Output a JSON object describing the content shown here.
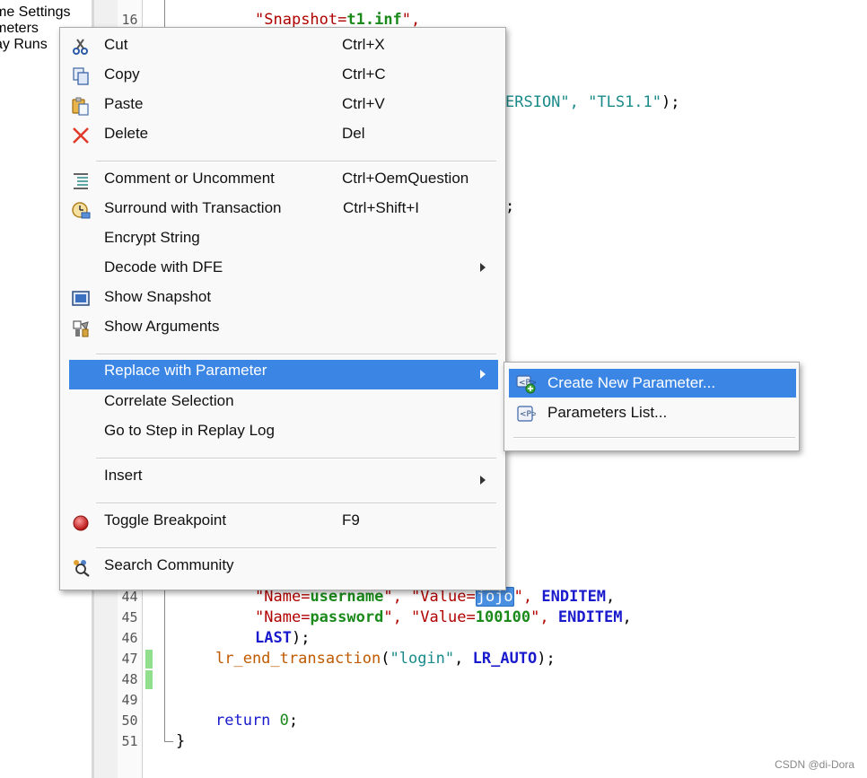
{
  "left_panel": {
    "items": [
      "me Settings",
      "meters",
      "ay Runs"
    ]
  },
  "editor": {
    "line_numbers": [
      "16",
      "44",
      "45",
      "46",
      "47",
      "48",
      "49",
      "50",
      "51"
    ],
    "visible_fragments": {
      "snapshot_open": "\"",
      "snapshot_key": "Snapshot=",
      "snapshot_val": "t1.inf",
      "snapshot_close": "\",",
      "tls_part1": "ERSION\", ",
      "tls_part2": "\"TLS1.1\"",
      "tls_part3": ");",
      "semicolon": ";"
    },
    "line44": {
      "q1": "\"",
      "k1": "Name=",
      "v1": "username",
      "q2": "\", ",
      "q3": "\"",
      "k2": "Value=",
      "v2": "jojo",
      "q4": "\", ",
      "kw": "ENDITEM",
      "end": ","
    },
    "line45": {
      "q1": "\"",
      "k1": "Name=",
      "v1": "password",
      "q2": "\", ",
      "q3": "\"",
      "k2": "Value=",
      "v2": "100100",
      "q4": "\", ",
      "kw": "ENDITEM",
      "end": ","
    },
    "line46": {
      "kw": "LAST",
      "end": ");"
    },
    "line47": {
      "fn": "lr_end_transaction",
      "p1": "(",
      "str": "\"login\"",
      "p2": ", ",
      "kw": "LR_AUTO",
      "p3": ");"
    },
    "line50": {
      "kw": "return",
      "num": "0",
      "end": ";"
    },
    "line51": {
      "brace": "}"
    }
  },
  "context_menu": {
    "items": [
      {
        "label": "Cut",
        "shortcut": "Ctrl+X",
        "icon": "scissors-icon"
      },
      {
        "label": "Copy",
        "shortcut": "Ctrl+C",
        "icon": "copy-icon"
      },
      {
        "label": "Paste",
        "shortcut": "Ctrl+V",
        "icon": "paste-icon"
      },
      {
        "label": "Delete",
        "shortcut": "Del",
        "icon": "delete-icon"
      },
      {
        "label": "Comment or Uncomment",
        "shortcut": "Ctrl+OemQuestion",
        "icon": "comment-icon"
      },
      {
        "label": "Surround with Transaction",
        "shortcut": "Ctrl+Shift+I",
        "icon": "transaction-clock-icon"
      },
      {
        "label": "Encrypt String"
      },
      {
        "label": "Decode with DFE"
      },
      {
        "label": "Show Snapshot",
        "icon": "snapshot-icon"
      },
      {
        "label": "Show Arguments",
        "icon": "arguments-icon"
      },
      {
        "label": "Replace with Parameter"
      },
      {
        "label": "Correlate Selection"
      },
      {
        "label": "Go to Step in Replay Log"
      },
      {
        "label": "Insert"
      },
      {
        "label": "Toggle Breakpoint",
        "shortcut": "F9",
        "icon": "breakpoint-icon"
      },
      {
        "label": "Search Community",
        "icon": "search-community-icon"
      }
    ],
    "colors": {
      "highlight": "#3b86e5",
      "breakpoint": "#cc2222"
    }
  },
  "submenu": {
    "items": [
      {
        "label": "Create New Parameter...",
        "icon": "new-parameter-icon"
      },
      {
        "label": "Parameters List...",
        "icon": "parameter-list-icon"
      }
    ]
  },
  "watermark": "CSDN @di-Dora"
}
